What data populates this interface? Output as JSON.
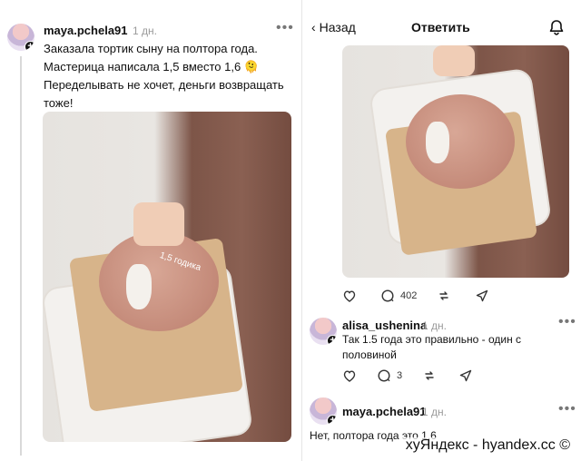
{
  "left_post": {
    "username": "maya.pchela91",
    "time": "1 дн.",
    "more": "•••",
    "text": "Заказала тортик сыну на полтора года. Мастерица написала 1,5 вместо 1,6 🫠 Переделывать не хочет, деньги возвращать тоже!"
  },
  "right_panel": {
    "back_label": "Назад",
    "title": "Ответить",
    "post_actions": {
      "comments_count": "402"
    },
    "reply1": {
      "username": "alisa_ushenina",
      "time": "1 дн.",
      "text": "Так 1.5 года это правильно - один с половиной",
      "comments_count": "3"
    },
    "reply2": {
      "username": "maya.pchela91",
      "time": "1 дн.",
      "text": "Нет, полтора года это 1,6"
    }
  },
  "watermark": "хуЯндекс - hyandex.cc ©",
  "cake_text": "1,5 годика",
  "icons": [
    "more-icon",
    "chevron-left-icon",
    "bell-icon",
    "heart-icon",
    "comment-icon",
    "repost-icon",
    "share-icon",
    "plus-icon"
  ]
}
